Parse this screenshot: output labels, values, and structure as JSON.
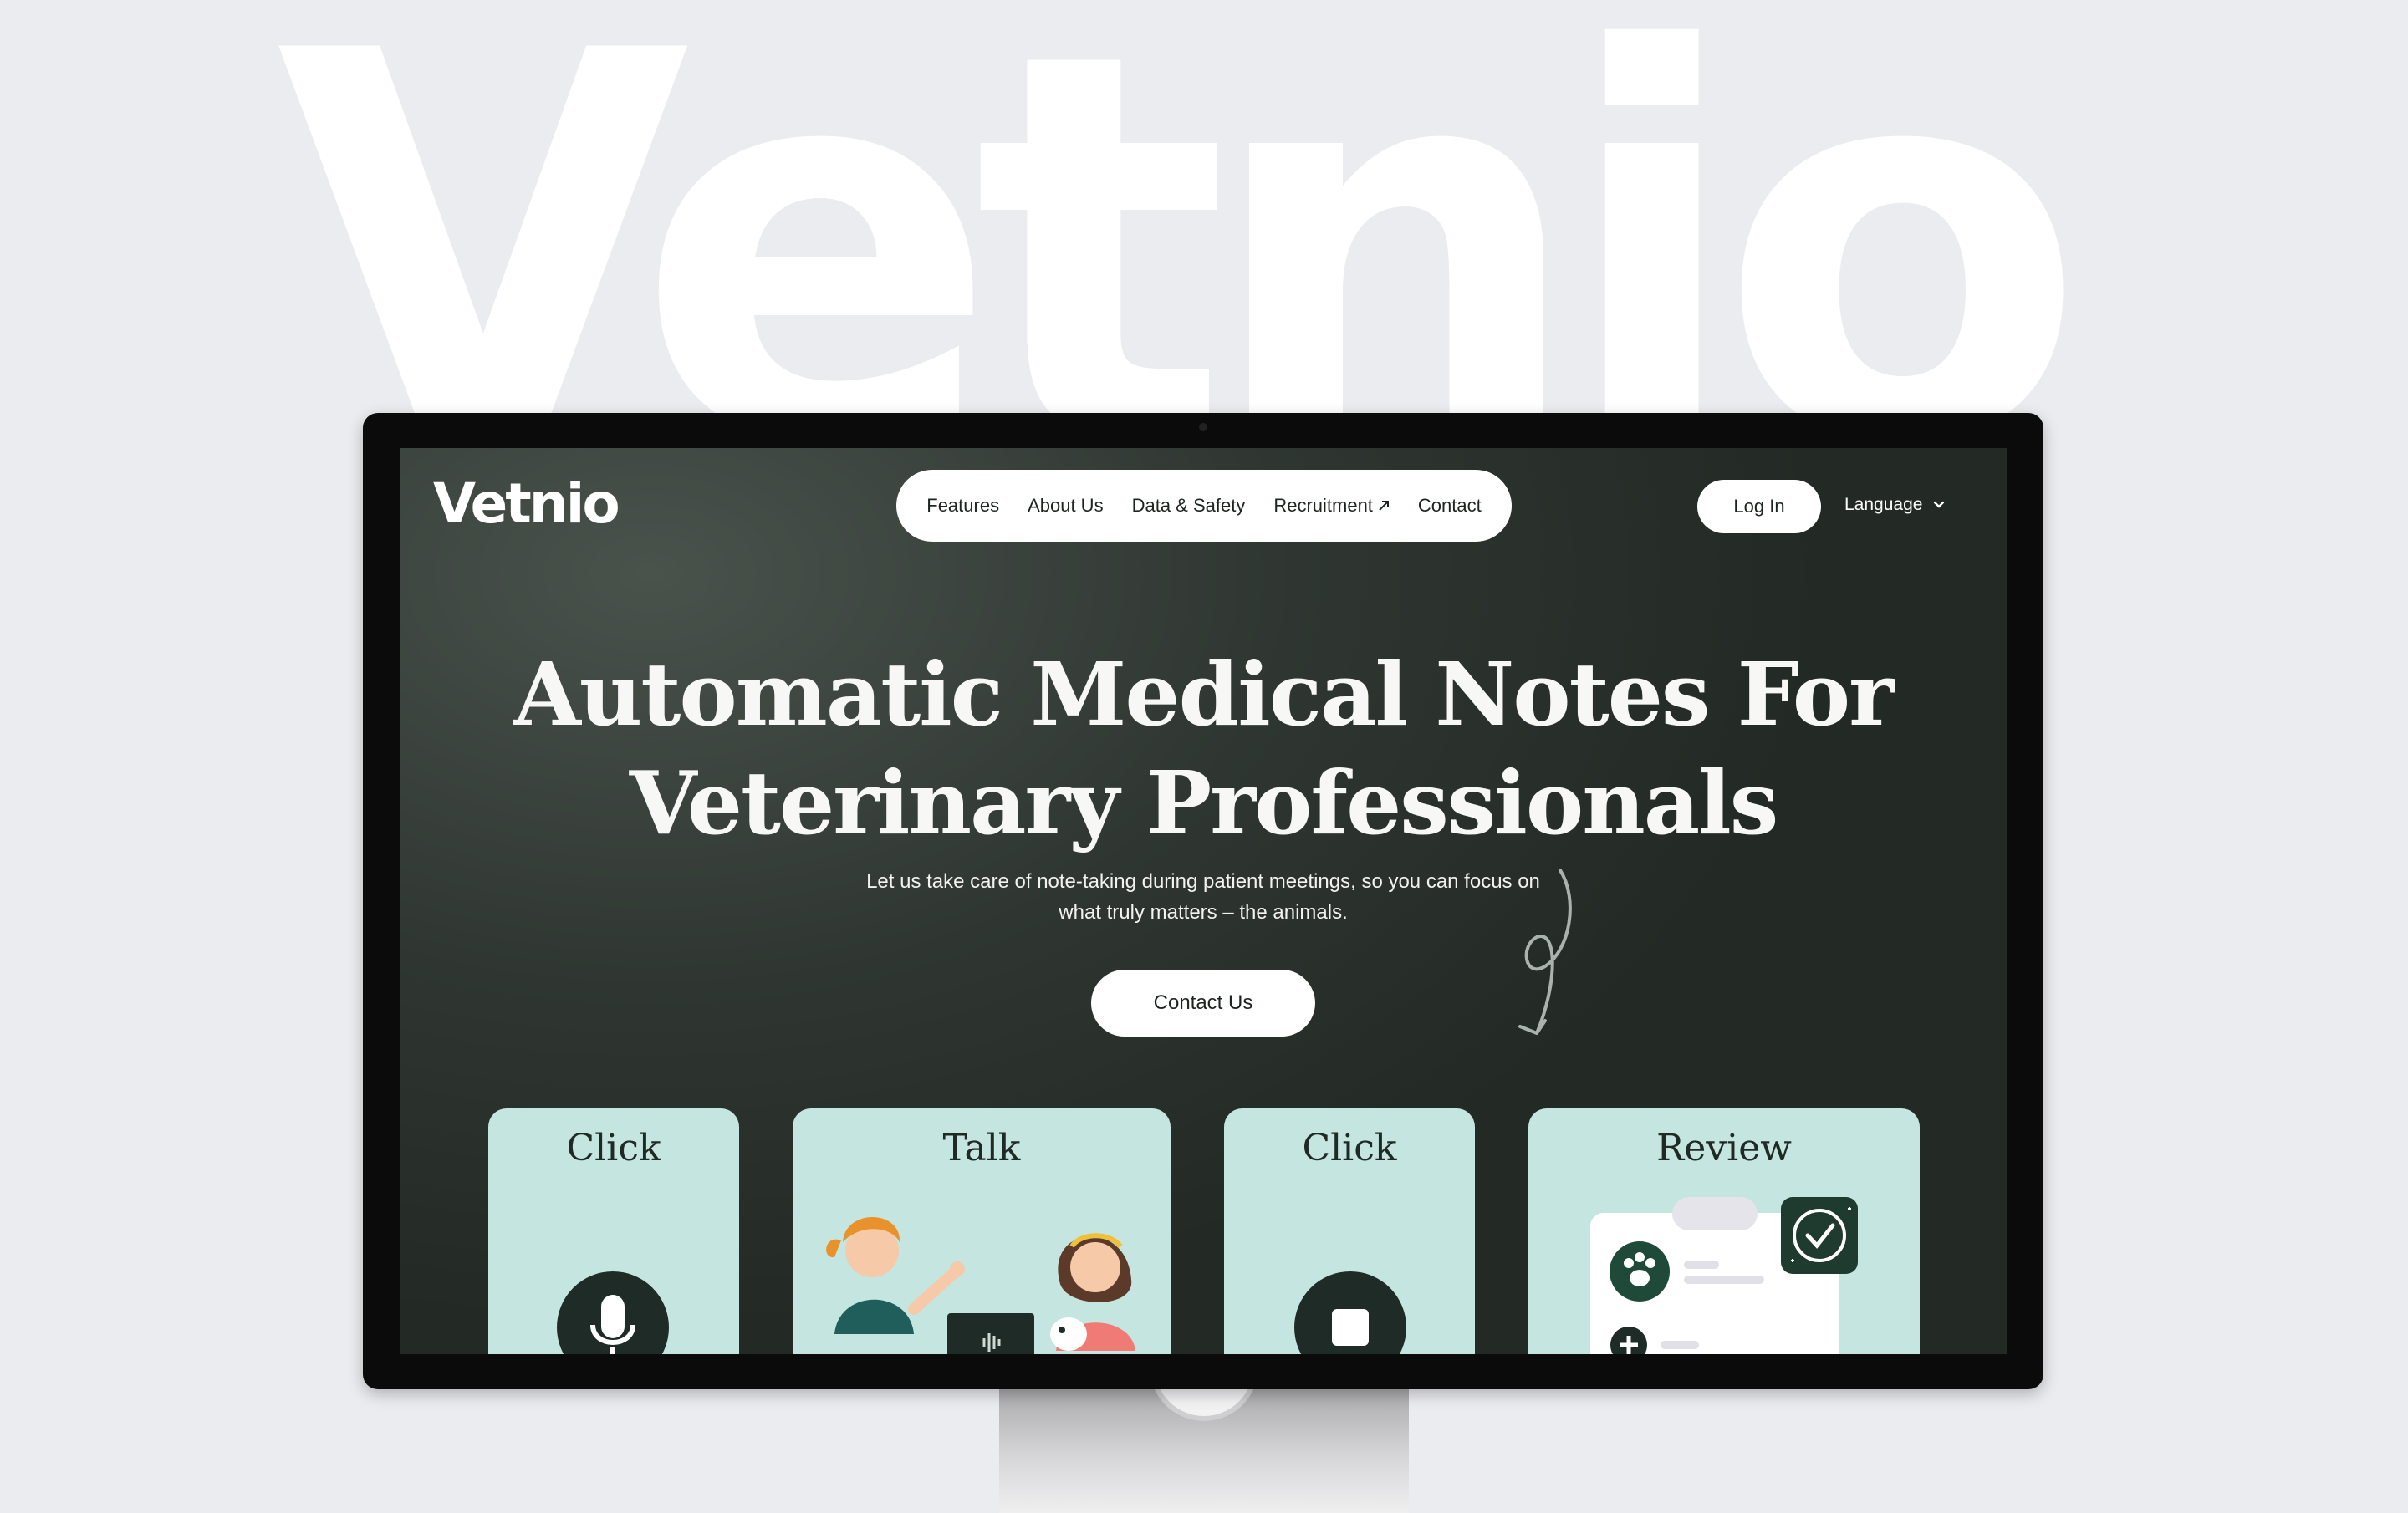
{
  "background": {
    "wordmark": "Vetnio"
  },
  "header": {
    "logo": "Vetnio",
    "nav": [
      {
        "label": "Features"
      },
      {
        "label": "About Us"
      },
      {
        "label": "Data & Safety"
      },
      {
        "label": "Recruitment",
        "icon": "external-arrow-icon"
      },
      {
        "label": "Contact"
      }
    ],
    "login_label": "Log In",
    "language_label": "Language"
  },
  "hero": {
    "title_line1": "Automatic Medical Notes For",
    "title_line2": "Veterinary Professionals",
    "subtitle_line1": "Let us take care of note-taking during patient meetings, so you can focus on",
    "subtitle_line2": "what truly matters – the animals.",
    "cta_label": "Contact Us"
  },
  "steps": [
    {
      "title": "Click",
      "icon": "microphone-icon"
    },
    {
      "title": "Talk",
      "icon": "vet-and-owner-illustration"
    },
    {
      "title": "Click",
      "icon": "stop-icon"
    },
    {
      "title": "Review",
      "icon": "medical-note-check-icon"
    }
  ],
  "colors": {
    "screen_bg": "#2f3631",
    "card_bg": "#c5e5e0",
    "dark_accent": "#1f2b26",
    "page_bg": "#ebecef"
  }
}
